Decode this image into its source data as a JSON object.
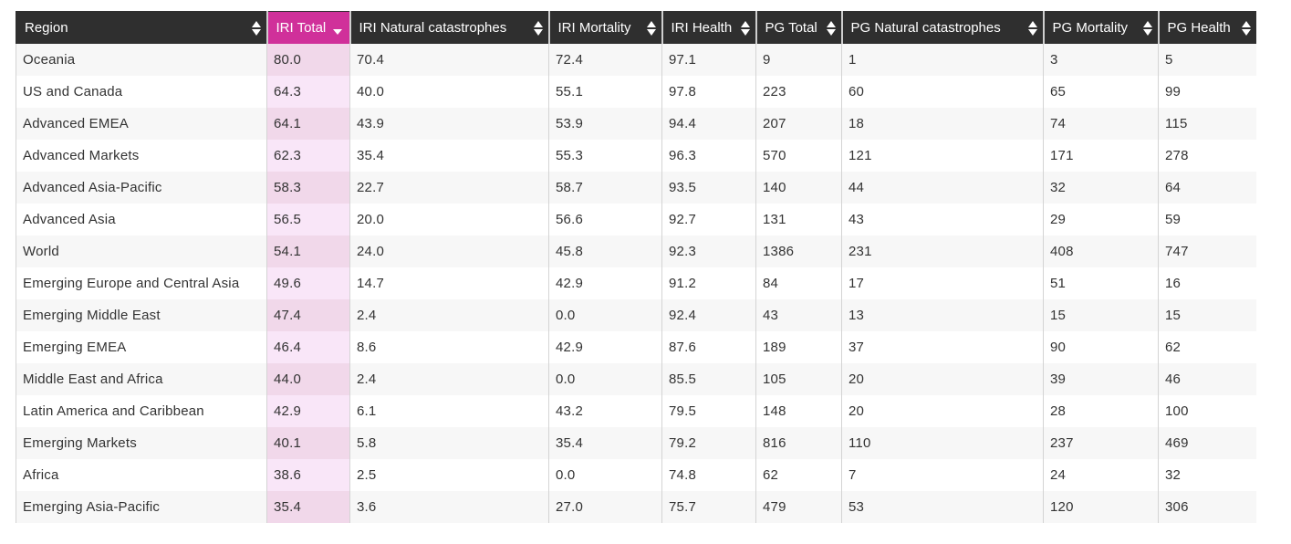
{
  "table": {
    "sorted_column": "IRI Total",
    "sort_direction": "descending",
    "accent_color": "#d0309a",
    "header_color": "#2f2f2f",
    "columns": [
      {
        "label": "Region",
        "icon": "sort-both-icon"
      },
      {
        "label": "IRI Total",
        "icon": "sort-desc-icon"
      },
      {
        "label": "IRI Natural catastrophes",
        "icon": "sort-both-icon"
      },
      {
        "label": "IRI Mortality",
        "icon": "sort-both-icon"
      },
      {
        "label": "IRI Health",
        "icon": "sort-both-icon"
      },
      {
        "label": "PG Total",
        "icon": "sort-both-icon"
      },
      {
        "label": "PG Natural catastrophes",
        "icon": "sort-both-icon"
      },
      {
        "label": "PG Mortality",
        "icon": "sort-both-icon"
      },
      {
        "label": "PG Health",
        "icon": "sort-both-icon"
      }
    ],
    "rows": [
      [
        "Oceania",
        "80.0",
        "70.4",
        "72.4",
        "97.1",
        "9",
        "1",
        "3",
        "5"
      ],
      [
        "US and Canada",
        "64.3",
        "40.0",
        "55.1",
        "97.8",
        "223",
        "60",
        "65",
        "99"
      ],
      [
        "Advanced EMEA",
        "64.1",
        "43.9",
        "53.9",
        "94.4",
        "207",
        "18",
        "74",
        "115"
      ],
      [
        "Advanced Markets",
        "62.3",
        "35.4",
        "55.3",
        "96.3",
        "570",
        "121",
        "171",
        "278"
      ],
      [
        "Advanced Asia-Pacific",
        "58.3",
        "22.7",
        "58.7",
        "93.5",
        "140",
        "44",
        "32",
        "64"
      ],
      [
        "Advanced Asia",
        "56.5",
        "20.0",
        "56.6",
        "92.7",
        "131",
        "43",
        "29",
        "59"
      ],
      [
        "World",
        "54.1",
        "24.0",
        "45.8",
        "92.3",
        "1386",
        "231",
        "408",
        "747"
      ],
      [
        "Emerging Europe and Central Asia",
        "49.6",
        "14.7",
        "42.9",
        "91.2",
        "84",
        "17",
        "51",
        "16"
      ],
      [
        "Emerging Middle East",
        "47.4",
        "2.4",
        "0.0",
        "92.4",
        "43",
        "13",
        "15",
        "15"
      ],
      [
        "Emerging EMEA",
        "46.4",
        "8.6",
        "42.9",
        "87.6",
        "189",
        "37",
        "90",
        "62"
      ],
      [
        "Middle East and Africa",
        "44.0",
        "2.4",
        "0.0",
        "85.5",
        "105",
        "20",
        "39",
        "46"
      ],
      [
        "Latin America and Caribbean",
        "42.9",
        "6.1",
        "43.2",
        "79.5",
        "148",
        "20",
        "28",
        "100"
      ],
      [
        "Emerging Markets",
        "40.1",
        "5.8",
        "35.4",
        "79.2",
        "816",
        "110",
        "237",
        "469"
      ],
      [
        "Africa",
        "38.6",
        "2.5",
        "0.0",
        "74.8",
        "62",
        "7",
        "24",
        "32"
      ],
      [
        "Emerging Asia-Pacific",
        "35.4",
        "3.6",
        "27.0",
        "75.7",
        "479",
        "53",
        "120",
        "306"
      ]
    ]
  }
}
